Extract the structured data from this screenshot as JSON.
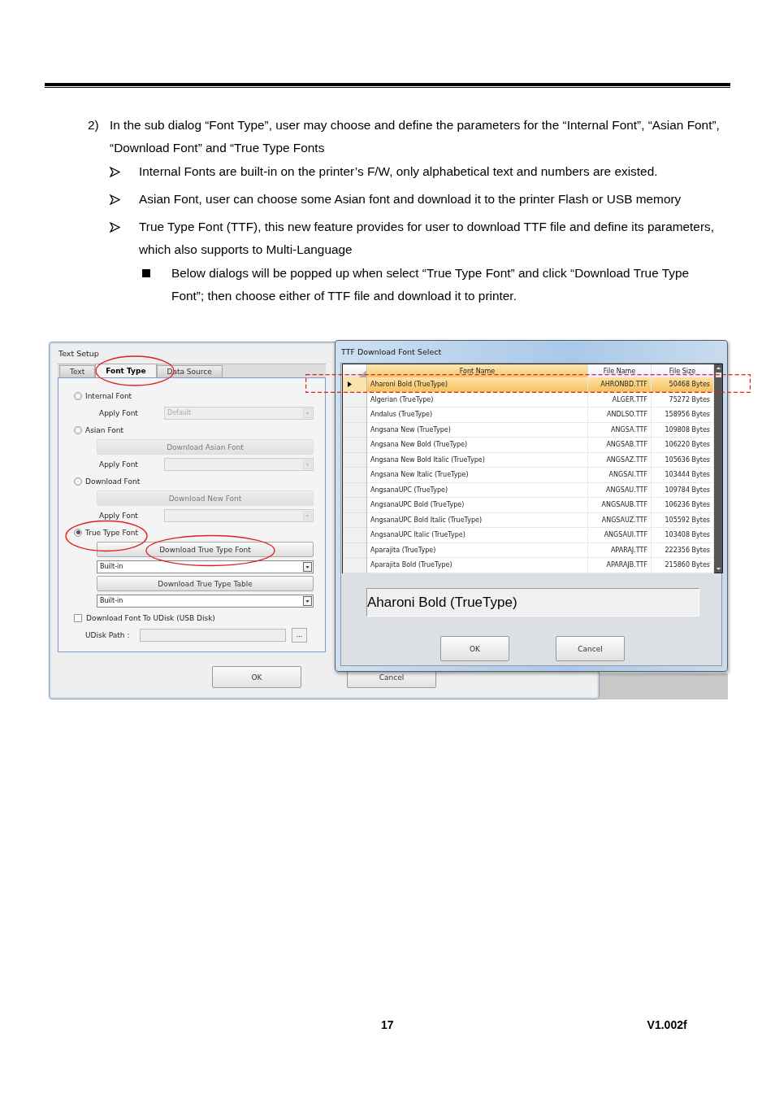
{
  "section": {
    "number": "2)",
    "text": "In the sub dialog “Font Type”, user may choose and define the parameters for the “Internal Font”, “Asian Font”, “Download Font” and “True Type Fonts",
    "bullets": [
      {
        "text": "Internal Fonts are built-in on the printer’s F/W, only alphabetical text and numbers are existed."
      },
      {
        "text": "Asian Font, user can choose some Asian font and download it to the printer Flash or USB memory"
      },
      {
        "text": "True Type Font (TTF), this new feature provides for user to download TTF file and define its parameters, which also supports to Multi-Language",
        "sub_bullets": [
          "Below dialogs will be popped up when select “True Type Font” and click “Download True Type Font”; then choose either of TTF file and download it to printer."
        ]
      }
    ]
  },
  "text_setup": {
    "title": "Text Setup",
    "tabs": [
      {
        "label": "Text",
        "selected": false
      },
      {
        "label": "Font Type",
        "selected": true
      },
      {
        "label": "Data Source",
        "selected": false
      }
    ],
    "options": [
      {
        "kind": "radio",
        "label": "Internal Font",
        "selected": false
      },
      {
        "kind": "combo",
        "label": "Apply Font",
        "value": "Default",
        "disabled": true
      },
      {
        "kind": "radio",
        "label": "Asian Font",
        "selected": false
      },
      {
        "kind": "button",
        "label": "Download Asian Font",
        "disabled": true
      },
      {
        "kind": "combo",
        "label": "Apply Font",
        "disabled": true
      },
      {
        "kind": "radio",
        "label": "Download Font",
        "selected": false
      },
      {
        "kind": "button",
        "label": "Download New Font",
        "disabled": true
      },
      {
        "kind": "combo",
        "label": "Apply Font",
        "disabled": true
      },
      {
        "kind": "radio",
        "label": "True Type Font",
        "selected": true
      },
      {
        "kind": "button",
        "label": "Download True Type Font",
        "disabled": false
      },
      {
        "kind": "dropdown",
        "value": "Built-in"
      },
      {
        "kind": "button",
        "label": "Download True Type Table",
        "disabled": false
      },
      {
        "kind": "dropdown",
        "value": "Built-in"
      },
      {
        "kind": "checkbox",
        "label": "Download Font To UDisk (USB Disk)",
        "checked": false
      },
      {
        "kind": "path",
        "label": "UDisk Path :",
        "browse": "..."
      }
    ],
    "buttons": [
      "OK",
      "Cancel"
    ]
  },
  "ttf_dialog": {
    "title": "TTF Download Font Select",
    "columns": [
      {
        "label": "Font Name",
        "highlighted": true
      },
      {
        "label": "File Name",
        "highlighted": false
      },
      {
        "label": "File Size",
        "highlighted": false
      }
    ],
    "rows": [
      {
        "font_name": "Aharoni Bold (TrueType)",
        "file_name": "AHRONBD.TTF",
        "file_size": "50468 Bytes",
        "selected": true
      },
      {
        "font_name": "Algerian (TrueType)",
        "file_name": "ALGER.TTF",
        "file_size": "75272 Bytes",
        "selected": false
      },
      {
        "font_name": "Andalus (TrueType)",
        "file_name": "ANDLSO.TTF",
        "file_size": "158956 Bytes",
        "selected": false
      },
      {
        "font_name": "Angsana New (TrueType)",
        "file_name": "ANGSA.TTF",
        "file_size": "109808 Bytes",
        "selected": false
      },
      {
        "font_name": "Angsana New Bold (TrueType)",
        "file_name": "ANGSAB.TTF",
        "file_size": "106220 Bytes",
        "selected": false
      },
      {
        "font_name": "Angsana New Bold Italic (TrueType)",
        "file_name": "ANGSAZ.TTF",
        "file_size": "105636 Bytes",
        "selected": false
      },
      {
        "font_name": "Angsana New Italic (TrueType)",
        "file_name": "ANGSAI.TTF",
        "file_size": "103444 Bytes",
        "selected": false
      },
      {
        "font_name": "AngsanaUPC (TrueType)",
        "file_name": "ANGSAU.TTF",
        "file_size": "109784 Bytes",
        "selected": false
      },
      {
        "font_name": "AngsanaUPC Bold (TrueType)",
        "file_name": "ANGSAUB.TTF",
        "file_size": "106236 Bytes",
        "selected": false
      },
      {
        "font_name": "AngsanaUPC Bold Italic (TrueType)",
        "file_name": "ANGSAUZ.TTF",
        "file_size": "105592 Bytes",
        "selected": false
      },
      {
        "font_name": "AngsanaUPC Italic (TrueType)",
        "file_name": "ANGSAUI.TTF",
        "file_size": "103408 Bytes",
        "selected": false
      },
      {
        "font_name": "Aparajita (TrueType)",
        "file_name": "APARAJ.TTF",
        "file_size": "222356 Bytes",
        "selected": false
      },
      {
        "font_name": "Aparajita Bold (TrueType)",
        "file_name": "APARAJB.TTF",
        "file_size": "215860 Bytes",
        "selected": false
      }
    ],
    "selected_font": "Aharoni Bold (TrueType)",
    "buttons": [
      "OK",
      "Cancel"
    ]
  },
  "footer": {
    "page": "17",
    "version": "V1.002f"
  }
}
